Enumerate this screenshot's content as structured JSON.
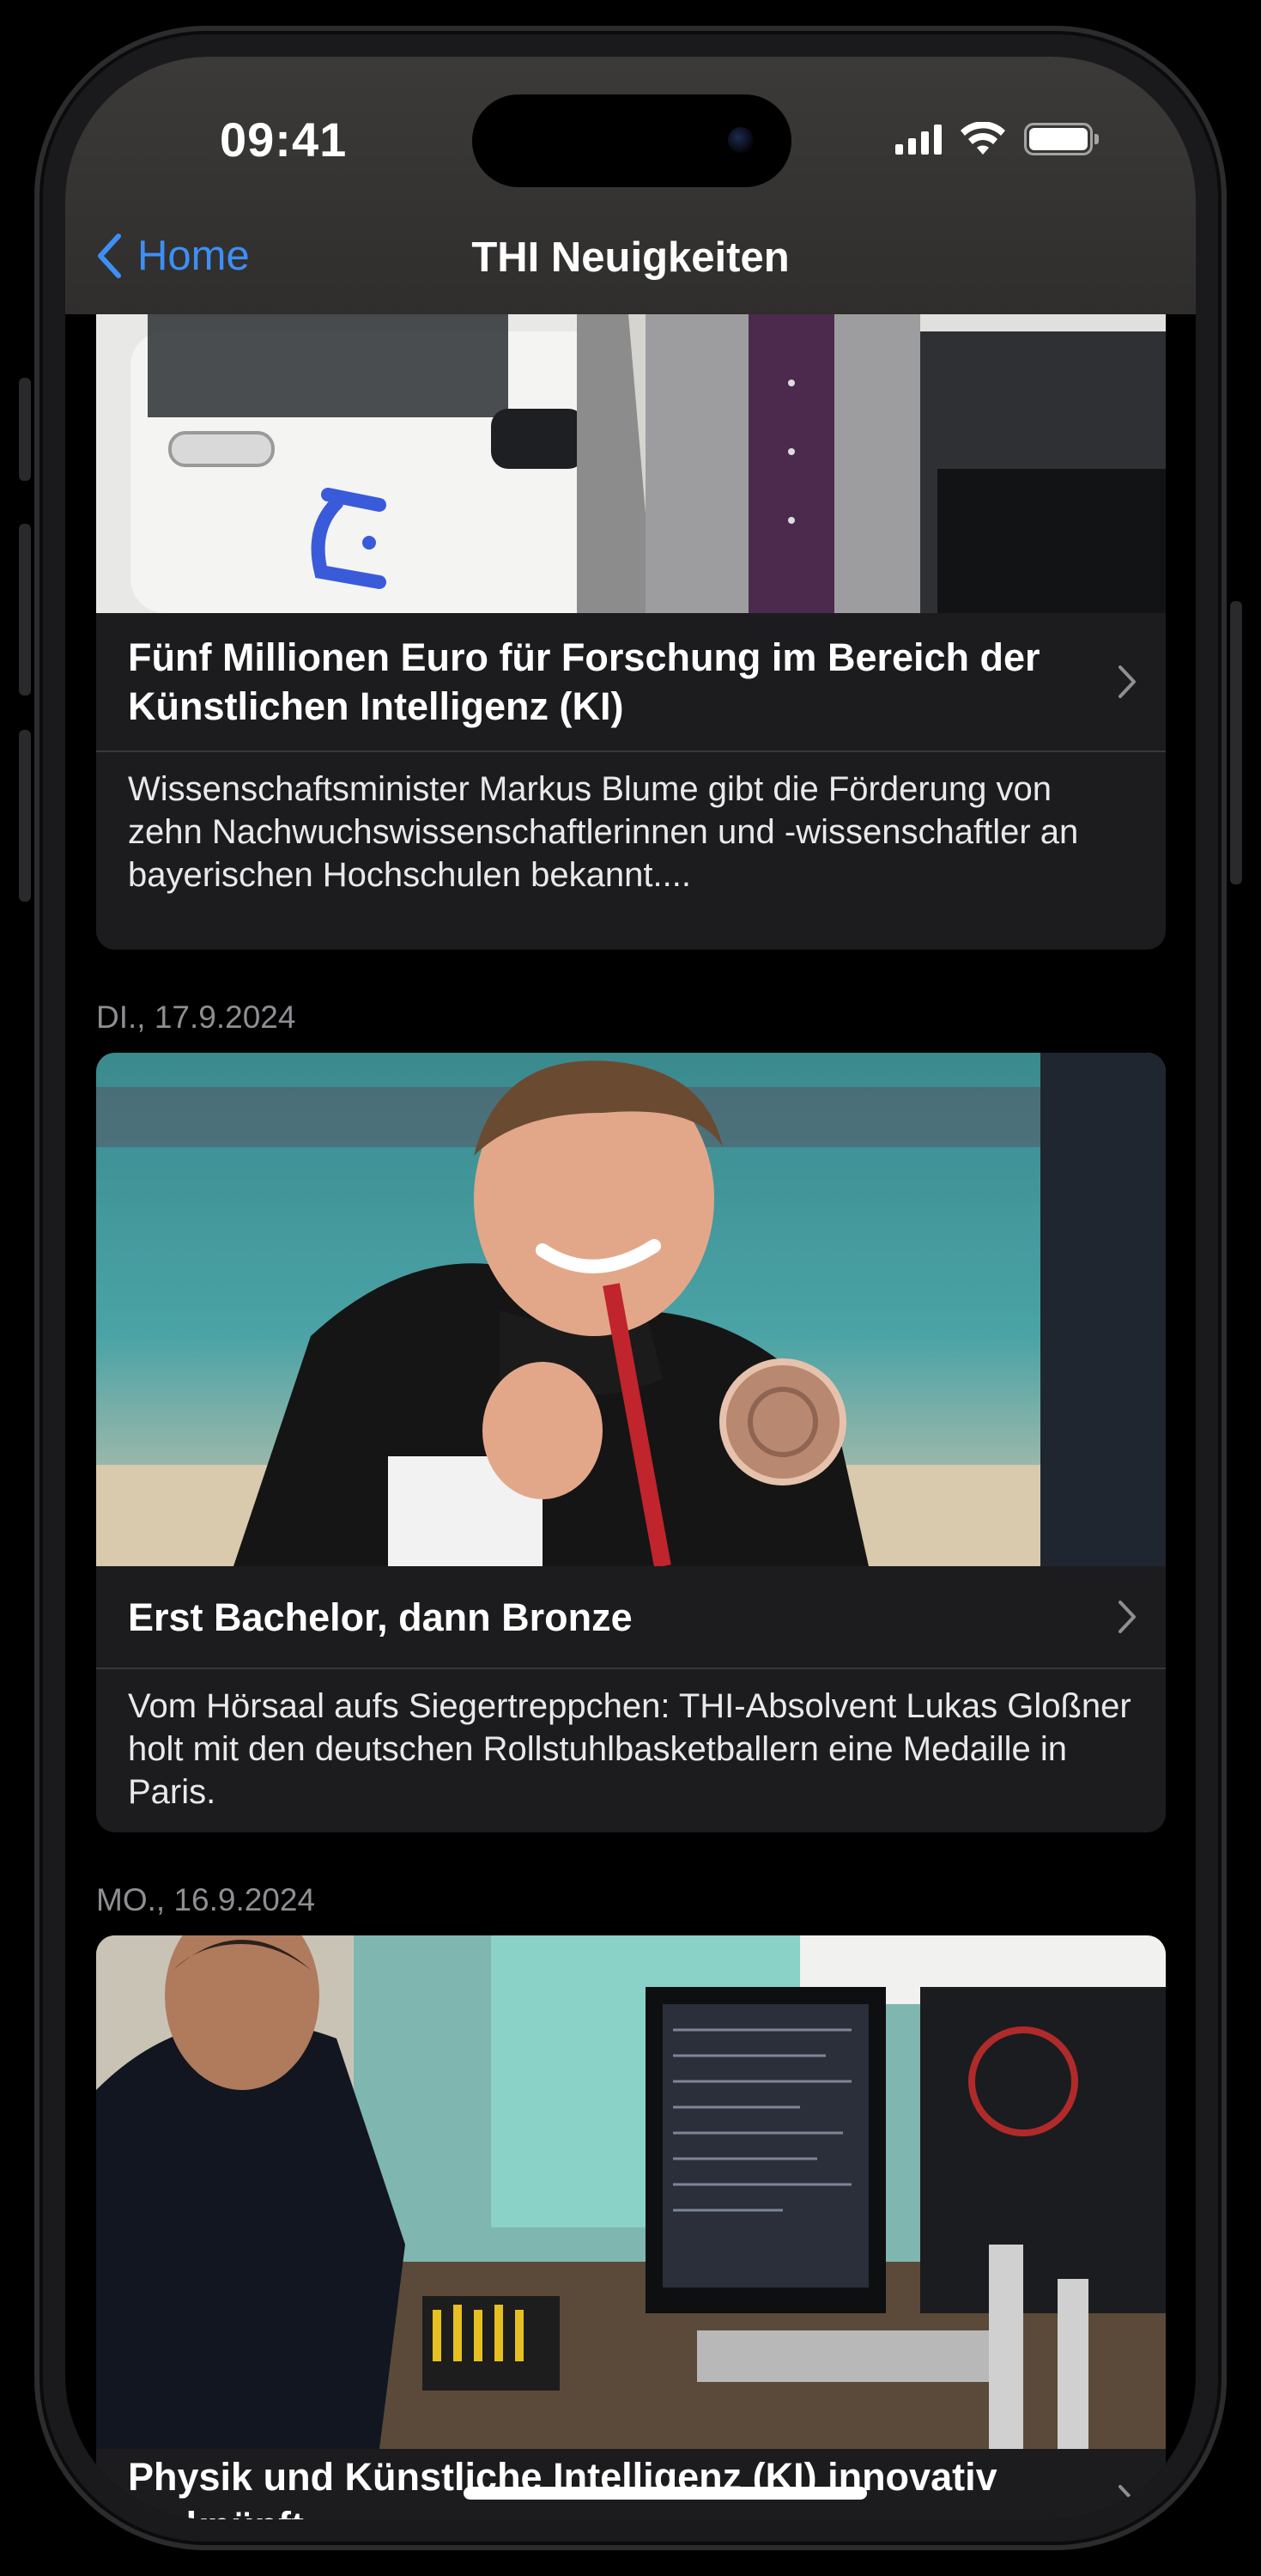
{
  "status_bar": {
    "time": "09:41",
    "signal_icon": "cellular-signal-icon",
    "wifi_icon": "wifi-icon",
    "battery_icon": "battery-icon"
  },
  "nav": {
    "back_label": "Home",
    "title": "THI Neuigkeiten"
  },
  "colors": {
    "accent": "#3d8ff5",
    "background": "#000000",
    "card": "#1c1c1e",
    "secondary_text": "#8e8e93"
  },
  "news": [
    {
      "date": "",
      "title": "Fünf Millionen Euro für Forschung im Bereich der Künstlichen Intelligenz (KI)",
      "description": "Wissenschaftsminister Markus Blume gibt die Förderung von zehn Nachwuchswissenschaftlerinnen und -wissenschaftler an bayerischen Hochschulen bekannt...."
    },
    {
      "date": "DI., 17.9.2024",
      "title": "Erst Bachelor, dann Bronze",
      "description": "Vom Hörsaal aufs Siegertreppchen: THI-Absolvent Lukas Gloßner holt mit den deutschen Rollstuhlbasketballern eine Medaille in Paris."
    },
    {
      "date": "MO., 16.9.2024",
      "title": "Physik und Künstliche Intelligenz (KI) innovativ verknüpft",
      "description": ""
    }
  ]
}
